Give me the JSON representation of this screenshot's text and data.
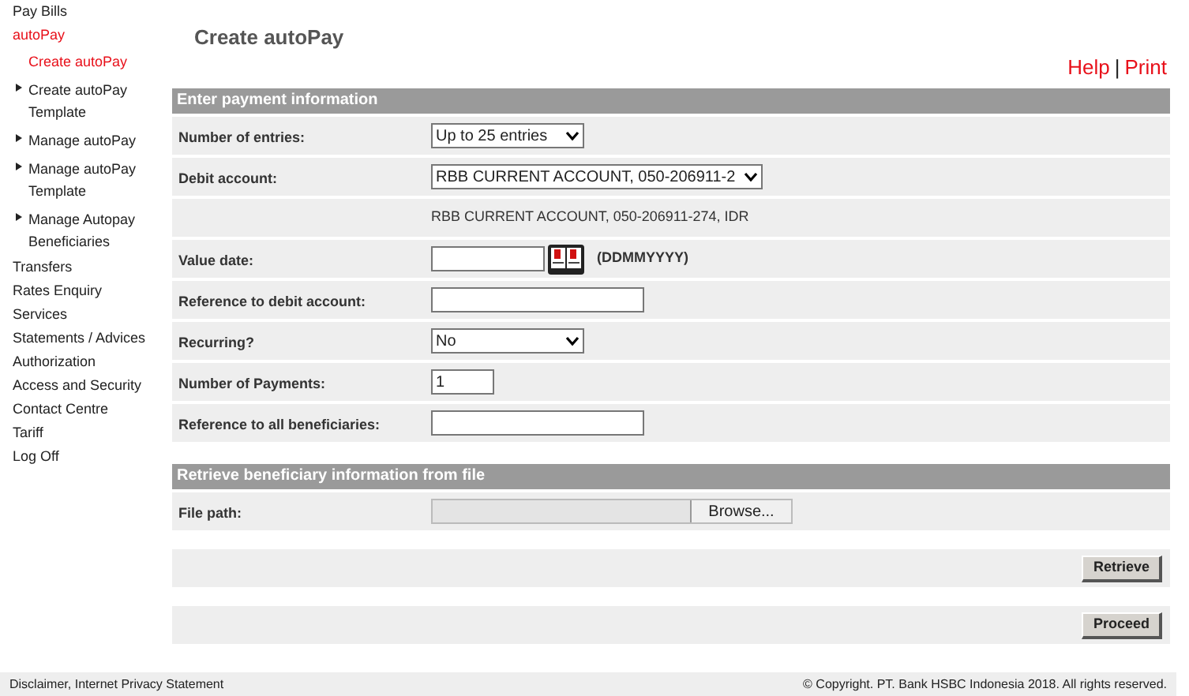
{
  "sidebar": {
    "items": [
      {
        "label": "Pay Bills",
        "selected": false
      },
      {
        "label": "autoPay",
        "selected": true,
        "children": [
          {
            "label": "Create autoPay",
            "selected": true
          },
          {
            "label": "Create autoPay Template",
            "selected": false
          },
          {
            "label": "Manage autoPay",
            "selected": false
          },
          {
            "label": "Manage autoPay Template",
            "selected": false
          },
          {
            "label": "Manage Autopay Beneficiaries",
            "selected": false
          }
        ]
      },
      {
        "label": "Transfers",
        "selected": false
      },
      {
        "label": "Rates Enquiry",
        "selected": false
      },
      {
        "label": "Services",
        "selected": false
      },
      {
        "label": "Statements / Advices",
        "selected": false
      },
      {
        "label": "Authorization",
        "selected": false
      },
      {
        "label": "Access and Security",
        "selected": false
      },
      {
        "label": "Contact Centre",
        "selected": false
      },
      {
        "label": "Tariff",
        "selected": false
      },
      {
        "label": "Log Off",
        "selected": false
      }
    ]
  },
  "page_title": "Create autoPay",
  "links": [
    "Help",
    "Print"
  ],
  "link_separator": "|",
  "payment_section": {
    "title": "Enter payment information",
    "rows": [
      {
        "kind": "select",
        "label": "Number of entries:",
        "value": "Up to 25 entries"
      },
      {
        "kind": "select",
        "label": "Debit account:",
        "value": "RBB CURRENT ACCOUNT, 050-206911-2",
        "wide": true
      },
      {
        "kind": "info",
        "value": "RBB CURRENT ACCOUNT, 050-206911-274, IDR"
      },
      {
        "kind": "date",
        "label": "Value date:",
        "hint": "(DDMMYYYY)"
      },
      {
        "kind": "text",
        "label": "Reference to debit account:"
      },
      {
        "kind": "select",
        "label": "Recurring?",
        "value": "No"
      },
      {
        "kind": "short",
        "label": "Number of Payments:",
        "value": "1"
      },
      {
        "kind": "text",
        "label": "Reference to all beneficiaries:"
      }
    ]
  },
  "file_section": {
    "title": "Retrieve beneficiary information from file",
    "label": "File path:",
    "button": "Browse..."
  },
  "buttons": [
    "Retrieve",
    "Proceed"
  ],
  "footer": {
    "left": "Disclaimer, Internet Privacy Statement",
    "right": "© Copyright. PT. Bank HSBC Indonesia 2018. All rights reserved."
  }
}
